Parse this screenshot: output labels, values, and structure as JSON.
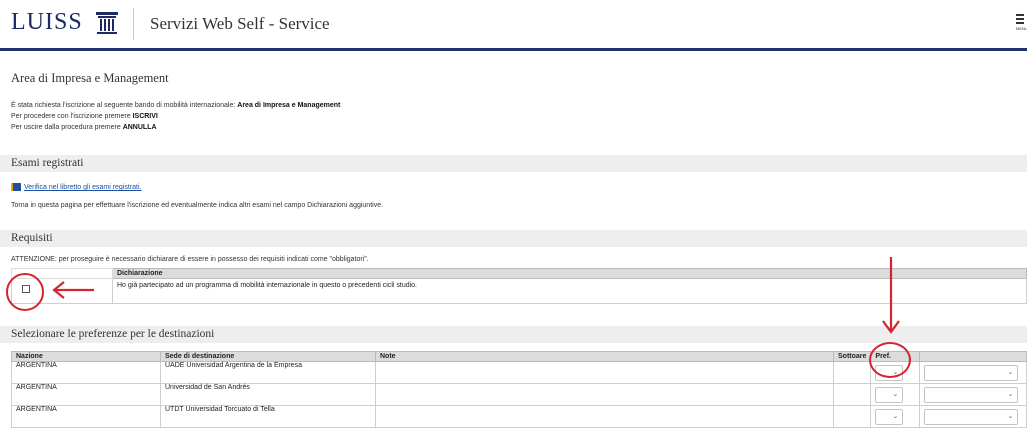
{
  "header": {
    "logo_text": "LUISS",
    "service_title": "Servizi Web Self - Service",
    "menu_label": "MENU"
  },
  "intro": {
    "title": "Area di Impresa e Management",
    "line1_prefix": "È stata richiesta l'iscrizione al seguente bando di mobilità internazionale:",
    "line1_bold": "Area di Impresa e Management",
    "line2_prefix": "Per procedere con l'iscrizione premere",
    "line2_bold": "ISCRIVI",
    "line3_prefix": "Per uscire dalla procedura premere",
    "line3_bold": "ANNULLA"
  },
  "exams": {
    "section_title": "Esami registrati",
    "link_text": "Verifica nel libretto gli esami registrati.",
    "note": "Torna in questa pagina per effettuare l'iscrizione ed eventualmente indica altri esami nel campo Dichiarazioni aggiuntive."
  },
  "requirements": {
    "section_title": "Requisiti",
    "warning": "ATTENZIONE: per proseguire è necessario dichiarare di essere in possesso dei requisiti indicati come \"obbligatori\".",
    "column_header": "Dichiarazione",
    "rows": [
      {
        "text": "Ho già partecipato ad un programma di mobilità internazionale in questo o precedenti cicli studio."
      }
    ]
  },
  "destinations": {
    "section_title": "Selezionare le preferenze per le destinazioni",
    "columns": {
      "country": "Nazione",
      "site": "Sede di destinazione",
      "notes": "Note",
      "sub": "Sottoare",
      "pref": "Pref."
    },
    "rows": [
      {
        "country": "ARGENTINA",
        "site": "UADE Universidad Argentina de la Empresa",
        "notes": ""
      },
      {
        "country": "ARGENTINA",
        "site": "Universidad de San Andrés",
        "notes": ""
      },
      {
        "country": "ARGENTINA",
        "site": "UTDT Universidad Torcuato di Tella",
        "notes": ""
      }
    ]
  },
  "colors": {
    "brand": "#1d2a63",
    "annotation": "#d42332",
    "section_bg": "#eeeeee"
  }
}
